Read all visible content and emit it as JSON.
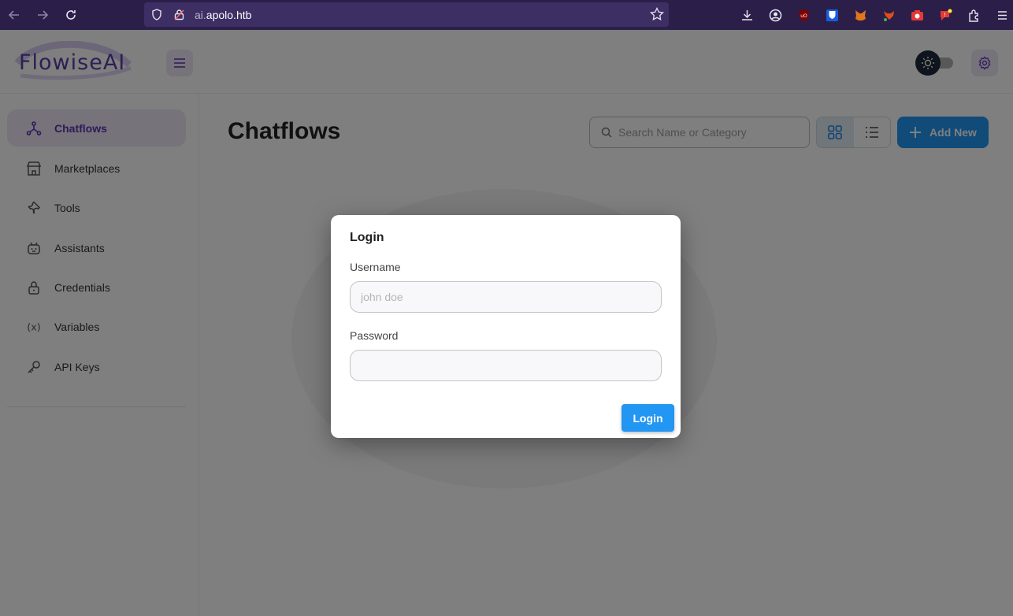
{
  "browser": {
    "url_prefix": "ai.",
    "url_domain": "apolo.htb"
  },
  "header": {
    "logo_text": "FlowiseAI"
  },
  "sidebar": {
    "items": [
      {
        "label": "Chatflows",
        "icon": "hierarchy-icon",
        "active": true
      },
      {
        "label": "Marketplaces",
        "icon": "store-icon",
        "active": false
      },
      {
        "label": "Tools",
        "icon": "wrench-icon",
        "active": false
      },
      {
        "label": "Assistants",
        "icon": "robot-icon",
        "active": false
      },
      {
        "label": "Credentials",
        "icon": "lock-icon",
        "active": false
      },
      {
        "label": "Variables",
        "icon": "variable-icon",
        "active": false
      },
      {
        "label": "API Keys",
        "icon": "key-icon",
        "active": false
      }
    ]
  },
  "main": {
    "title": "Chatflows",
    "search_placeholder": "Search Name or Category",
    "add_new_label": "Add New"
  },
  "login_dialog": {
    "title": "Login",
    "username_label": "Username",
    "username_placeholder": "john doe",
    "password_label": "Password",
    "submit_label": "Login"
  },
  "colors": {
    "accent": "#2196f3",
    "brand": "#5e35b1",
    "browser_bar": "#2b1f4a"
  }
}
